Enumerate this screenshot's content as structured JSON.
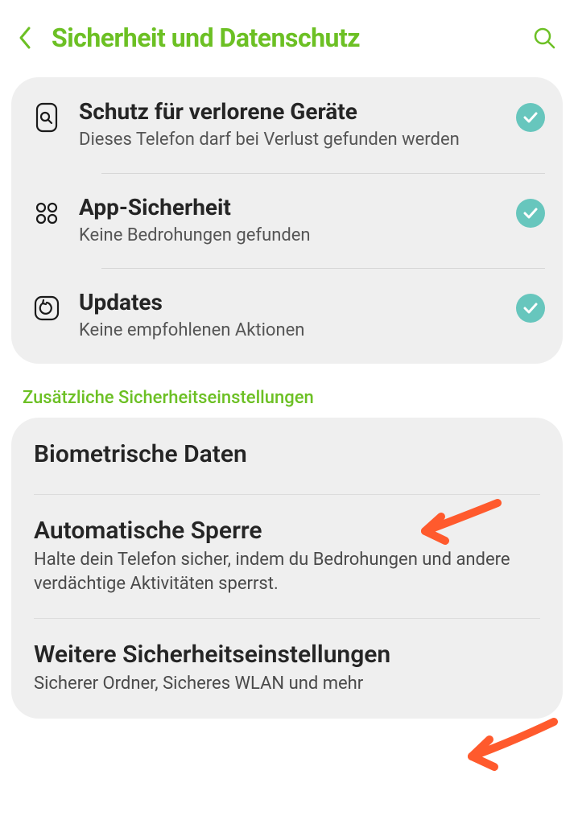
{
  "header": {
    "title": "Sicherheit und Datenschutz"
  },
  "status_card": [
    {
      "title": "Schutz für verlorene Geräte",
      "subtitle": "Dieses Telefon darf bei Verlust gefunden werden"
    },
    {
      "title": "App-Sicherheit",
      "subtitle": "Keine Bedrohungen gefunden"
    },
    {
      "title": "Updates",
      "subtitle": "Keine empfohlenen Aktionen"
    }
  ],
  "section_label": "Zusätzliche Sicherheitseinstellungen",
  "additional": [
    {
      "title": "Biometrische Daten",
      "subtitle": ""
    },
    {
      "title": "Automatische Sperre",
      "subtitle": "Halte dein Telefon sicher, indem du Bedrohungen und andere verdächtige Aktivitäten sperrst."
    },
    {
      "title": "Weitere Sicherheitseinstellungen",
      "subtitle": "Sicherer Ordner, Sicheres WLAN und mehr"
    }
  ]
}
